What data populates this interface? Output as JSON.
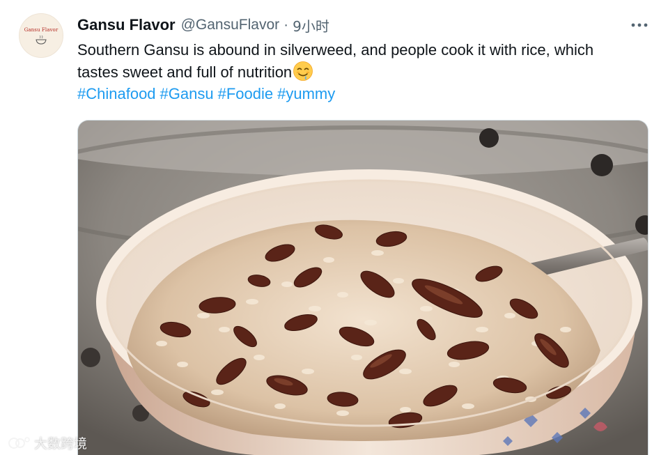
{
  "avatar": {
    "text": "Gansu Flavor"
  },
  "author": {
    "display_name": "Gansu Flavor",
    "handle": "@GansuFlavor",
    "separator": "·",
    "time": "9小时"
  },
  "tweet": {
    "text": "Southern Gansu is abound in silverweed, and people cook it with rice, which tastes sweet and full of nutrition",
    "emoji": "relieved-drooling-face",
    "hashtags": [
      "#Chinafood",
      "#Gansu",
      "#Foodie",
      "#yummy"
    ]
  },
  "media": {
    "description_icon": "photo"
  },
  "watermark": {
    "text": "大数跨境"
  },
  "colors": {
    "link": "#1d9bf0",
    "secondary": "#536471",
    "primary": "#0f1419"
  }
}
